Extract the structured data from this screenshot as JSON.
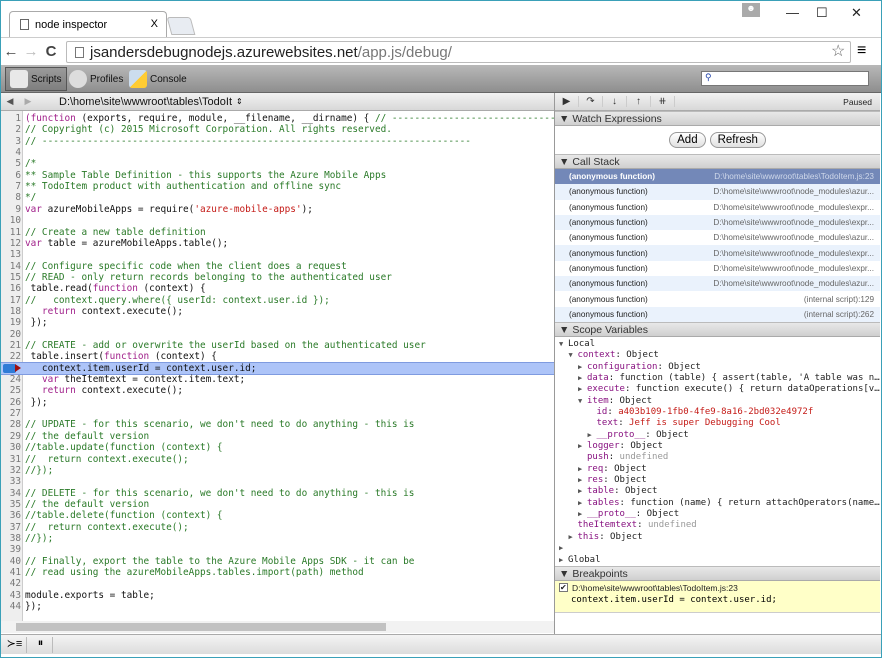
{
  "browser": {
    "tab_title": "node inspector",
    "tab_close": "X",
    "url_host": "jsandersdebugnodejs.azurewebsites.net",
    "url_path": "/app.js/debug/"
  },
  "toolbar": {
    "items": [
      {
        "label": "Scripts",
        "icon": "scripts-icon"
      },
      {
        "label": "Profiles",
        "icon": "profiles-icon"
      },
      {
        "label": "Console",
        "icon": "console-icon"
      }
    ],
    "search_placeholder": ""
  },
  "sources": {
    "file": "D:\\home\\site\\wwwroot\\tables\\TodoIt"
  },
  "debugger": {
    "status": "Paused"
  },
  "code": {
    "current_line": 23,
    "breakpoint_line": 23,
    "lines": [
      [
        [
          "k",
          "(function"
        ],
        [
          "p",
          " (exports, require, module, __filename, __dirname) { "
        ],
        [
          "c",
          "// -----------------------------------------------"
        ]
      ],
      [
        [
          "c",
          "// Copyright (c) 2015 Microsoft Corporation. All rights reserved."
        ]
      ],
      [
        [
          "c",
          "// ----------------------------------------------------------------------------"
        ]
      ],
      [],
      [
        [
          "c",
          "/*"
        ]
      ],
      [
        [
          "c",
          "** Sample Table Definition - this supports the Azure Mobile Apps"
        ]
      ],
      [
        [
          "c",
          "** TodoItem product with authentication and offline sync"
        ]
      ],
      [
        [
          "c",
          "*/"
        ]
      ],
      [
        [
          "k",
          "var"
        ],
        [
          "p",
          " azureMobileApps = require("
        ],
        [
          "s",
          "'azure-mobile-apps'"
        ],
        [
          "p",
          ");"
        ]
      ],
      [],
      [
        [
          "c",
          "// Create a new table definition"
        ]
      ],
      [
        [
          "k",
          "var"
        ],
        [
          "p",
          " table = azureMobileApps.table();"
        ]
      ],
      [],
      [
        [
          "c",
          "// Configure specific code when the client does a request"
        ]
      ],
      [
        [
          "c",
          "// READ - only return records belonging to the authenticated user"
        ]
      ],
      [
        [
          "p",
          " table.read("
        ],
        [
          "k",
          "function"
        ],
        [
          "p",
          " (context) {"
        ]
      ],
      [
        [
          "c",
          "//   context.query.where({ userId: context.user.id });"
        ]
      ],
      [
        [
          "p",
          "   "
        ],
        [
          "k",
          "return"
        ],
        [
          "p",
          " context.execute();"
        ]
      ],
      [
        [
          "p",
          " });"
        ]
      ],
      [],
      [
        [
          "c",
          "// CREATE - add or overwrite the userId based on the authenticated user"
        ]
      ],
      [
        [
          "p",
          " table.insert("
        ],
        [
          "k",
          "function"
        ],
        [
          "p",
          " (context) {"
        ]
      ],
      [
        [
          "p",
          "   context.item.userId = context.user.id;"
        ]
      ],
      [
        [
          "p",
          "   "
        ],
        [
          "k",
          "var"
        ],
        [
          "p",
          " theItemtext = context.item.text;"
        ]
      ],
      [
        [
          "p",
          "   "
        ],
        [
          "k",
          "return"
        ],
        [
          "p",
          " context.execute();"
        ]
      ],
      [
        [
          "p",
          " });"
        ]
      ],
      [],
      [
        [
          "c",
          "// UPDATE - for this scenario, we don't need to do anything - this is"
        ]
      ],
      [
        [
          "c",
          "// the default version"
        ]
      ],
      [
        [
          "c",
          "//table.update(function (context) {"
        ]
      ],
      [
        [
          "c",
          "//  return context.execute();"
        ]
      ],
      [
        [
          "c",
          "//});"
        ]
      ],
      [],
      [
        [
          "c",
          "// DELETE - for this scenario, we don't need to do anything - this is"
        ]
      ],
      [
        [
          "c",
          "// the default version"
        ]
      ],
      [
        [
          "c",
          "//table.delete(function (context) {"
        ]
      ],
      [
        [
          "c",
          "//  return context.execute();"
        ]
      ],
      [
        [
          "c",
          "//});"
        ]
      ],
      [],
      [
        [
          "c",
          "// Finally, export the table to the Azure Mobile Apps SDK - it can be"
        ]
      ],
      [
        [
          "c",
          "// read using the azureMobileApps.tables.import(path) method"
        ]
      ],
      [],
      [
        [
          "p",
          "module.exports = table;"
        ]
      ],
      [
        [
          "p",
          "});"
        ]
      ]
    ]
  },
  "panels": {
    "watch": {
      "title": "Watch Expressions",
      "add": "Add",
      "refresh": "Refresh"
    },
    "callstack": {
      "title": "Call Stack",
      "frames": [
        {
          "fn": "(anonymous function)",
          "loc": "D:\\home\\site\\wwwroot\\tables\\TodoItem.js:23",
          "selected": true
        },
        {
          "fn": "(anonymous function)",
          "loc": "D:\\home\\site\\wwwroot\\node_modules\\azur..."
        },
        {
          "fn": "(anonymous function)",
          "loc": "D:\\home\\site\\wwwroot\\node_modules\\expr..."
        },
        {
          "fn": "(anonymous function)",
          "loc": "D:\\home\\site\\wwwroot\\node_modules\\expr..."
        },
        {
          "fn": "(anonymous function)",
          "loc": "D:\\home\\site\\wwwroot\\node_modules\\azur..."
        },
        {
          "fn": "(anonymous function)",
          "loc": "D:\\home\\site\\wwwroot\\node_modules\\expr..."
        },
        {
          "fn": "(anonymous function)",
          "loc": "D:\\home\\site\\wwwroot\\node_modules\\expr..."
        },
        {
          "fn": "(anonymous function)",
          "loc": "D:\\home\\site\\wwwroot\\node_modules\\azur..."
        },
        {
          "fn": "(anonymous function)",
          "loc": "(internal script):129"
        },
        {
          "fn": "(anonymous function)",
          "loc": "(internal script):262"
        }
      ]
    },
    "scope": {
      "title": "Scope Variables",
      "rows": [
        {
          "d": 0,
          "t": "open",
          "n": "Local",
          "v": "",
          "cls": "vl",
          "plain": true
        },
        {
          "d": 1,
          "t": "open",
          "n": "context",
          "v": "Object",
          "cls": "vl"
        },
        {
          "d": 2,
          "t": "closed",
          "n": "configuration",
          "v": "Object",
          "cls": "vl"
        },
        {
          "d": 2,
          "t": "closed",
          "n": "data",
          "v": "function (table) { assert(table, 'A table was n…",
          "cls": "vl"
        },
        {
          "d": 2,
          "t": "closed",
          "n": "execute",
          "v": "function execute() { return dataOperations[v…",
          "cls": "vl"
        },
        {
          "d": 2,
          "t": "open",
          "n": "item",
          "v": "Object",
          "cls": "vl"
        },
        {
          "d": 3,
          "t": "none",
          "n": "id",
          "v": "a403b109-1fb0-4fe9-8a16-2bd032e4972f",
          "cls": "str"
        },
        {
          "d": 3,
          "t": "none",
          "n": "text",
          "v": "Jeff is super Debugging Cool",
          "cls": "str"
        },
        {
          "d": 3,
          "t": "closed",
          "n": "__proto__",
          "v": "Object",
          "cls": "vl"
        },
        {
          "d": 2,
          "t": "closed",
          "n": "logger",
          "v": "Object",
          "cls": "vl"
        },
        {
          "d": 2,
          "t": "none",
          "n": "push",
          "v": "undefined",
          "cls": "und"
        },
        {
          "d": 2,
          "t": "closed",
          "n": "req",
          "v": "Object",
          "cls": "vl"
        },
        {
          "d": 2,
          "t": "closed",
          "n": "res",
          "v": "Object",
          "cls": "vl"
        },
        {
          "d": 2,
          "t": "closed",
          "n": "table",
          "v": "Object",
          "cls": "vl"
        },
        {
          "d": 2,
          "t": "closed",
          "n": "tables",
          "v": "function (name) { return attachOperators(name…",
          "cls": "vl"
        },
        {
          "d": 2,
          "t": "closed",
          "n": "__proto__",
          "v": "Object",
          "cls": "vl"
        },
        {
          "d": 1,
          "t": "none",
          "n": "theItemtext",
          "v": "undefined",
          "cls": "und"
        },
        {
          "d": 1,
          "t": "closed",
          "n": "this",
          "v": "Object",
          "cls": "vl"
        },
        {
          "d": 0,
          "t": "closed",
          "n": "",
          "v": "",
          "cls": "vl",
          "plain": true
        },
        {
          "d": 0,
          "t": "closed",
          "n": "Global",
          "v": "",
          "cls": "vl",
          "plain": true
        }
      ]
    },
    "breakpoints": {
      "title": "Breakpoints",
      "items": [
        {
          "file": "D:\\home\\site\\wwwroot\\tables\\TodoItem.js:23",
          "code": "context.item.userId = context.user.id;",
          "checked": true
        }
      ]
    }
  }
}
